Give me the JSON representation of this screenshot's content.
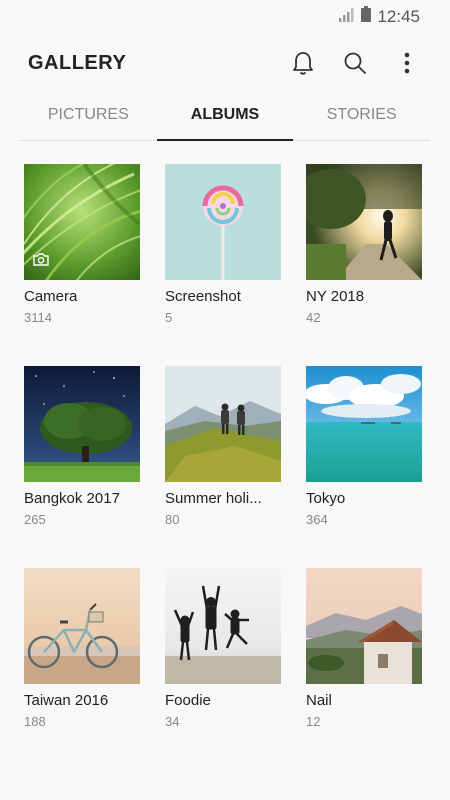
{
  "status": {
    "time": "12:45"
  },
  "app": {
    "title": "GALLERY"
  },
  "icons": {
    "notifications": "bell-icon",
    "search": "search-icon",
    "more": "more-vert-icon"
  },
  "tabs": [
    {
      "label": "PICTURES",
      "active": false
    },
    {
      "label": "ALBUMS",
      "active": true
    },
    {
      "label": "STORIES",
      "active": false
    }
  ],
  "albums": [
    {
      "name": "Camera",
      "count": "3114"
    },
    {
      "name": "Screenshot",
      "count": "5"
    },
    {
      "name": "NY 2018",
      "count": "42"
    },
    {
      "name": "Bangkok 2017",
      "count": "265"
    },
    {
      "name": "Summer holi...",
      "count": "80"
    },
    {
      "name": "Tokyo",
      "count": "364"
    },
    {
      "name": "Taiwan 2016",
      "count": "188"
    },
    {
      "name": "Foodie",
      "count": "34"
    },
    {
      "name": "Nail",
      "count": "12"
    }
  ]
}
